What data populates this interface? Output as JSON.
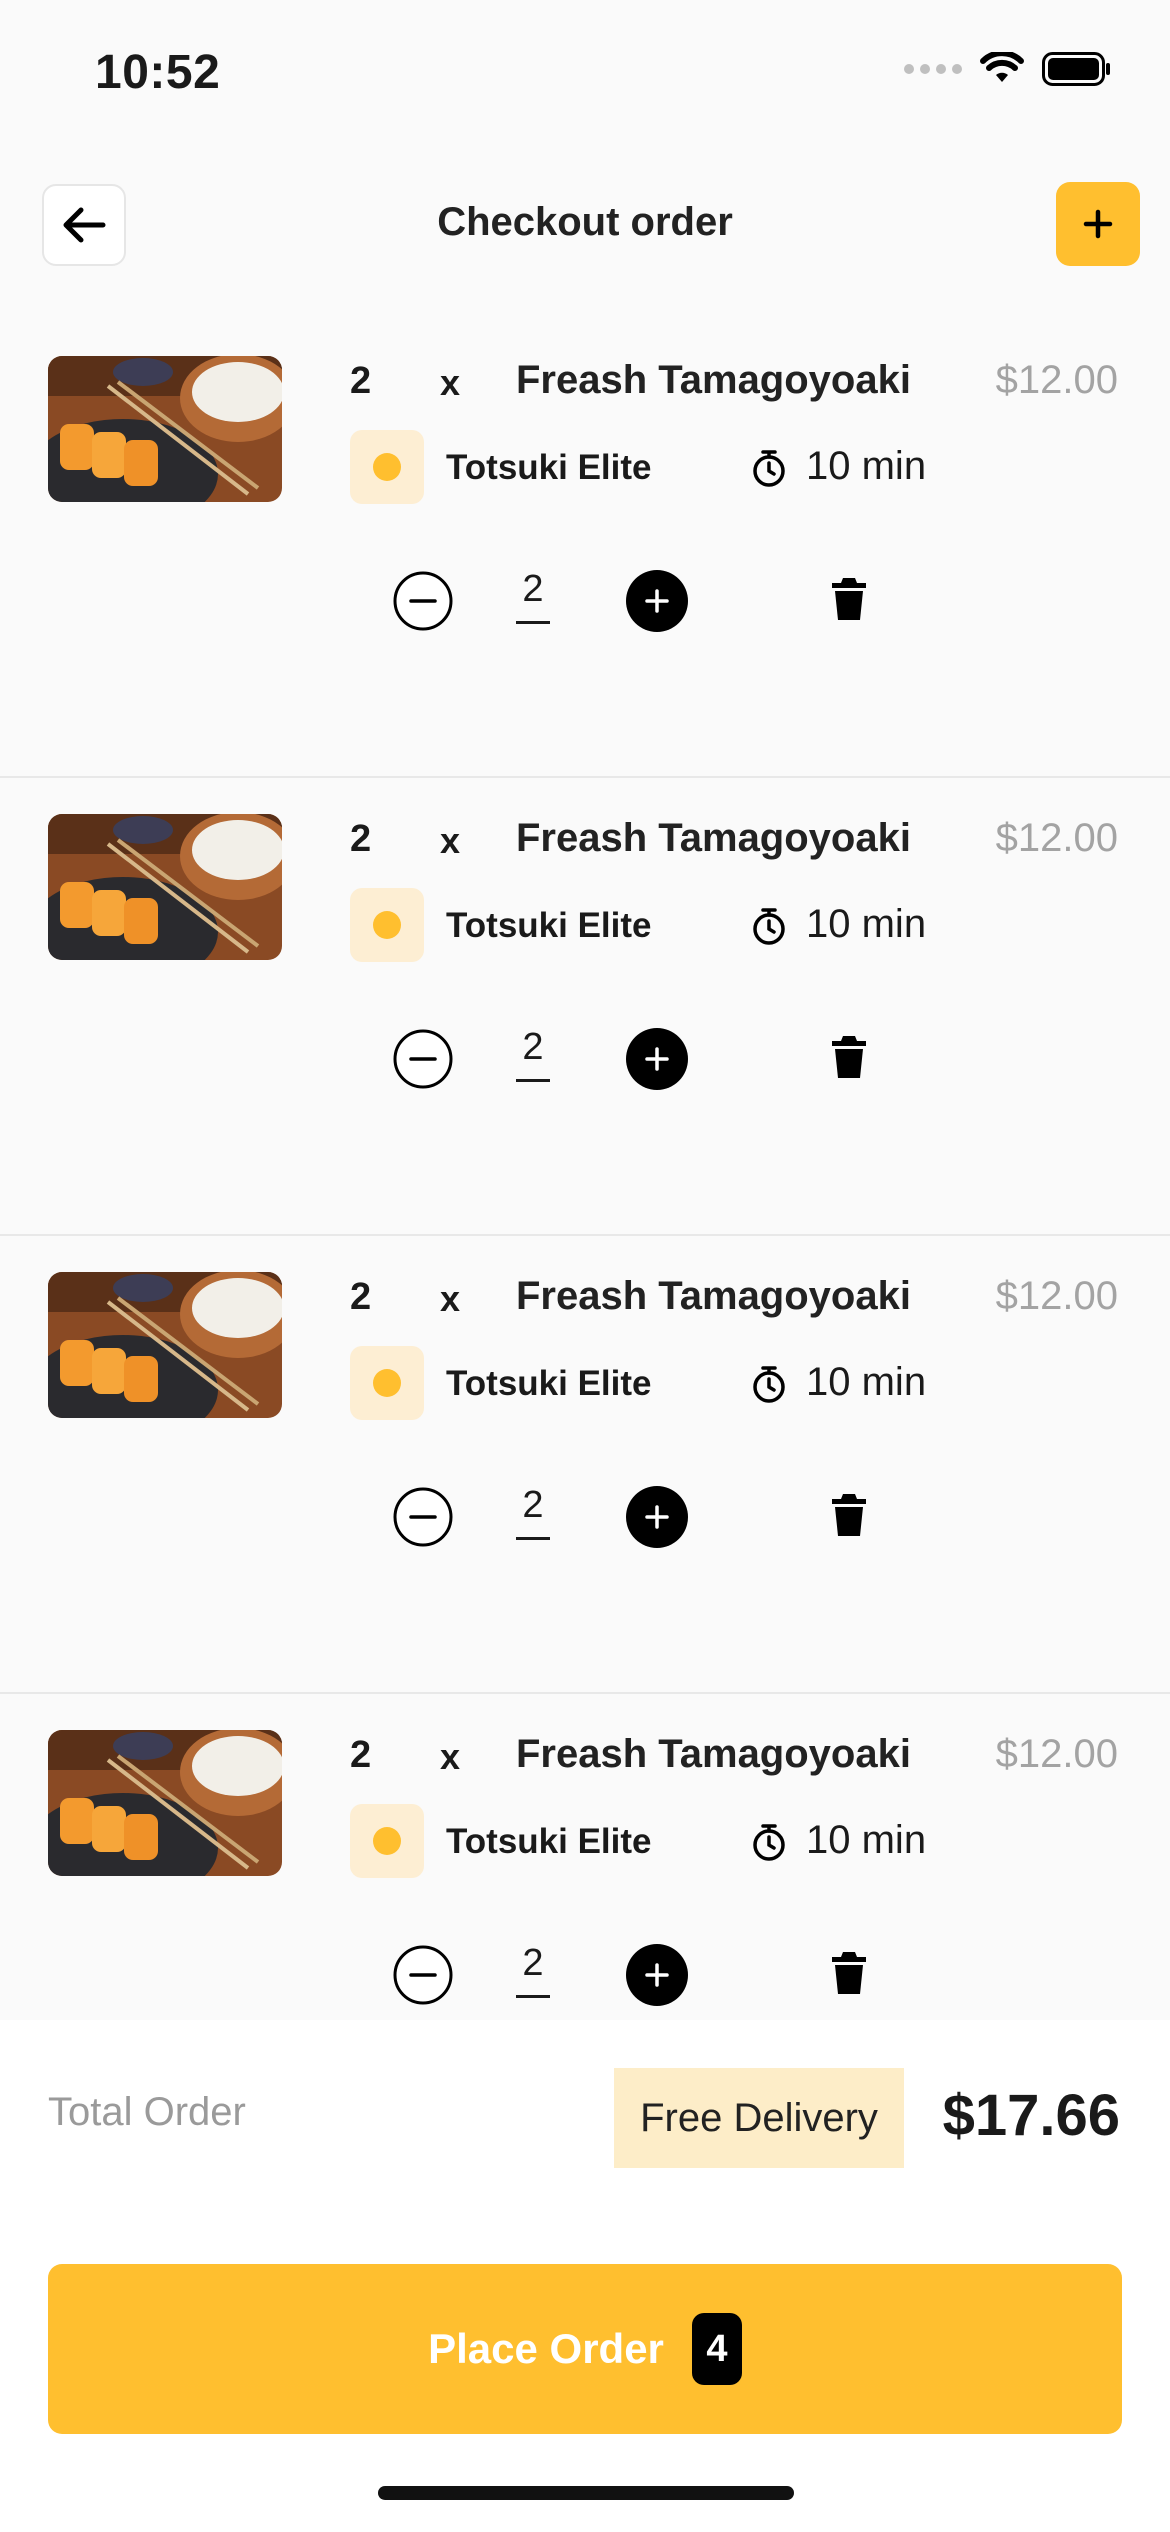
{
  "status_bar": {
    "time": "10:52"
  },
  "header": {
    "title": "Checkout order"
  },
  "items": [
    {
      "quantity": "2",
      "x": "x",
      "name": "Freash Tamagoyoaki",
      "price": "$12.00",
      "restaurant": "Totsuki Elite",
      "time": "10 min",
      "stepper_value": "2"
    },
    {
      "quantity": "2",
      "x": "x",
      "name": "Freash Tamagoyoaki",
      "price": "$12.00",
      "restaurant": "Totsuki Elite",
      "time": "10 min",
      "stepper_value": "2"
    },
    {
      "quantity": "2",
      "x": "x",
      "name": "Freash Tamagoyoaki",
      "price": "$12.00",
      "restaurant": "Totsuki Elite",
      "time": "10 min",
      "stepper_value": "2"
    },
    {
      "quantity": "2",
      "x": "x",
      "name": "Freash Tamagoyoaki",
      "price": "$12.00",
      "restaurant": "Totsuki Elite",
      "time": "10 min",
      "stepper_value": "2"
    }
  ],
  "summary": {
    "total_label": "Total Order",
    "delivery_badge": "Free Delivery",
    "total_amount": "$17.66"
  },
  "place_order": {
    "label": "Place Order",
    "count": "4"
  },
  "colors": {
    "accent": "#ffbf2f",
    "badge_bg": "#fdedc8",
    "price_grey": "#a3a3a3"
  }
}
